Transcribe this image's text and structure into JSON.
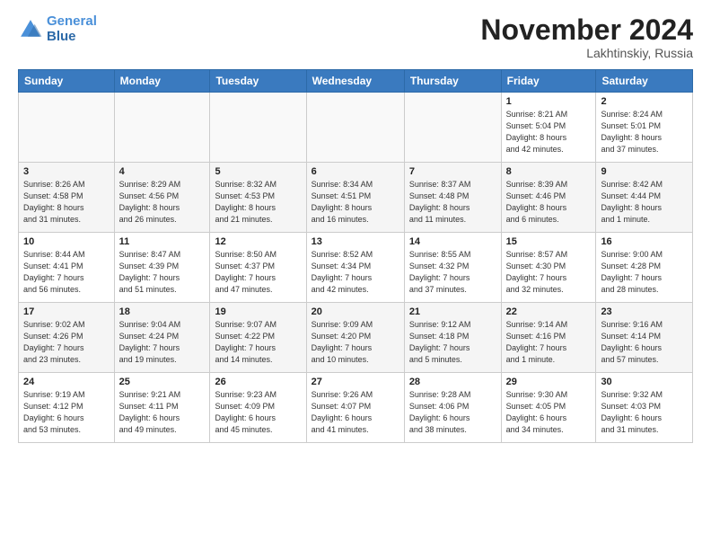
{
  "header": {
    "logo_line1": "General",
    "logo_line2": "Blue",
    "month_title": "November 2024",
    "location": "Lakhtinskiy, Russia"
  },
  "weekdays": [
    "Sunday",
    "Monday",
    "Tuesday",
    "Wednesday",
    "Thursday",
    "Friday",
    "Saturday"
  ],
  "weeks": [
    [
      {
        "day": "",
        "info": ""
      },
      {
        "day": "",
        "info": ""
      },
      {
        "day": "",
        "info": ""
      },
      {
        "day": "",
        "info": ""
      },
      {
        "day": "",
        "info": ""
      },
      {
        "day": "1",
        "info": "Sunrise: 8:21 AM\nSunset: 5:04 PM\nDaylight: 8 hours\nand 42 minutes."
      },
      {
        "day": "2",
        "info": "Sunrise: 8:24 AM\nSunset: 5:01 PM\nDaylight: 8 hours\nand 37 minutes."
      }
    ],
    [
      {
        "day": "3",
        "info": "Sunrise: 8:26 AM\nSunset: 4:58 PM\nDaylight: 8 hours\nand 31 minutes."
      },
      {
        "day": "4",
        "info": "Sunrise: 8:29 AM\nSunset: 4:56 PM\nDaylight: 8 hours\nand 26 minutes."
      },
      {
        "day": "5",
        "info": "Sunrise: 8:32 AM\nSunset: 4:53 PM\nDaylight: 8 hours\nand 21 minutes."
      },
      {
        "day": "6",
        "info": "Sunrise: 8:34 AM\nSunset: 4:51 PM\nDaylight: 8 hours\nand 16 minutes."
      },
      {
        "day": "7",
        "info": "Sunrise: 8:37 AM\nSunset: 4:48 PM\nDaylight: 8 hours\nand 11 minutes."
      },
      {
        "day": "8",
        "info": "Sunrise: 8:39 AM\nSunset: 4:46 PM\nDaylight: 8 hours\nand 6 minutes."
      },
      {
        "day": "9",
        "info": "Sunrise: 8:42 AM\nSunset: 4:44 PM\nDaylight: 8 hours\nand 1 minute."
      }
    ],
    [
      {
        "day": "10",
        "info": "Sunrise: 8:44 AM\nSunset: 4:41 PM\nDaylight: 7 hours\nand 56 minutes."
      },
      {
        "day": "11",
        "info": "Sunrise: 8:47 AM\nSunset: 4:39 PM\nDaylight: 7 hours\nand 51 minutes."
      },
      {
        "day": "12",
        "info": "Sunrise: 8:50 AM\nSunset: 4:37 PM\nDaylight: 7 hours\nand 47 minutes."
      },
      {
        "day": "13",
        "info": "Sunrise: 8:52 AM\nSunset: 4:34 PM\nDaylight: 7 hours\nand 42 minutes."
      },
      {
        "day": "14",
        "info": "Sunrise: 8:55 AM\nSunset: 4:32 PM\nDaylight: 7 hours\nand 37 minutes."
      },
      {
        "day": "15",
        "info": "Sunrise: 8:57 AM\nSunset: 4:30 PM\nDaylight: 7 hours\nand 32 minutes."
      },
      {
        "day": "16",
        "info": "Sunrise: 9:00 AM\nSunset: 4:28 PM\nDaylight: 7 hours\nand 28 minutes."
      }
    ],
    [
      {
        "day": "17",
        "info": "Sunrise: 9:02 AM\nSunset: 4:26 PM\nDaylight: 7 hours\nand 23 minutes."
      },
      {
        "day": "18",
        "info": "Sunrise: 9:04 AM\nSunset: 4:24 PM\nDaylight: 7 hours\nand 19 minutes."
      },
      {
        "day": "19",
        "info": "Sunrise: 9:07 AM\nSunset: 4:22 PM\nDaylight: 7 hours\nand 14 minutes."
      },
      {
        "day": "20",
        "info": "Sunrise: 9:09 AM\nSunset: 4:20 PM\nDaylight: 7 hours\nand 10 minutes."
      },
      {
        "day": "21",
        "info": "Sunrise: 9:12 AM\nSunset: 4:18 PM\nDaylight: 7 hours\nand 5 minutes."
      },
      {
        "day": "22",
        "info": "Sunrise: 9:14 AM\nSunset: 4:16 PM\nDaylight: 7 hours\nand 1 minute."
      },
      {
        "day": "23",
        "info": "Sunrise: 9:16 AM\nSunset: 4:14 PM\nDaylight: 6 hours\nand 57 minutes."
      }
    ],
    [
      {
        "day": "24",
        "info": "Sunrise: 9:19 AM\nSunset: 4:12 PM\nDaylight: 6 hours\nand 53 minutes."
      },
      {
        "day": "25",
        "info": "Sunrise: 9:21 AM\nSunset: 4:11 PM\nDaylight: 6 hours\nand 49 minutes."
      },
      {
        "day": "26",
        "info": "Sunrise: 9:23 AM\nSunset: 4:09 PM\nDaylight: 6 hours\nand 45 minutes."
      },
      {
        "day": "27",
        "info": "Sunrise: 9:26 AM\nSunset: 4:07 PM\nDaylight: 6 hours\nand 41 minutes."
      },
      {
        "day": "28",
        "info": "Sunrise: 9:28 AM\nSunset: 4:06 PM\nDaylight: 6 hours\nand 38 minutes."
      },
      {
        "day": "29",
        "info": "Sunrise: 9:30 AM\nSunset: 4:05 PM\nDaylight: 6 hours\nand 34 minutes."
      },
      {
        "day": "30",
        "info": "Sunrise: 9:32 AM\nSunset: 4:03 PM\nDaylight: 6 hours\nand 31 minutes."
      }
    ]
  ]
}
